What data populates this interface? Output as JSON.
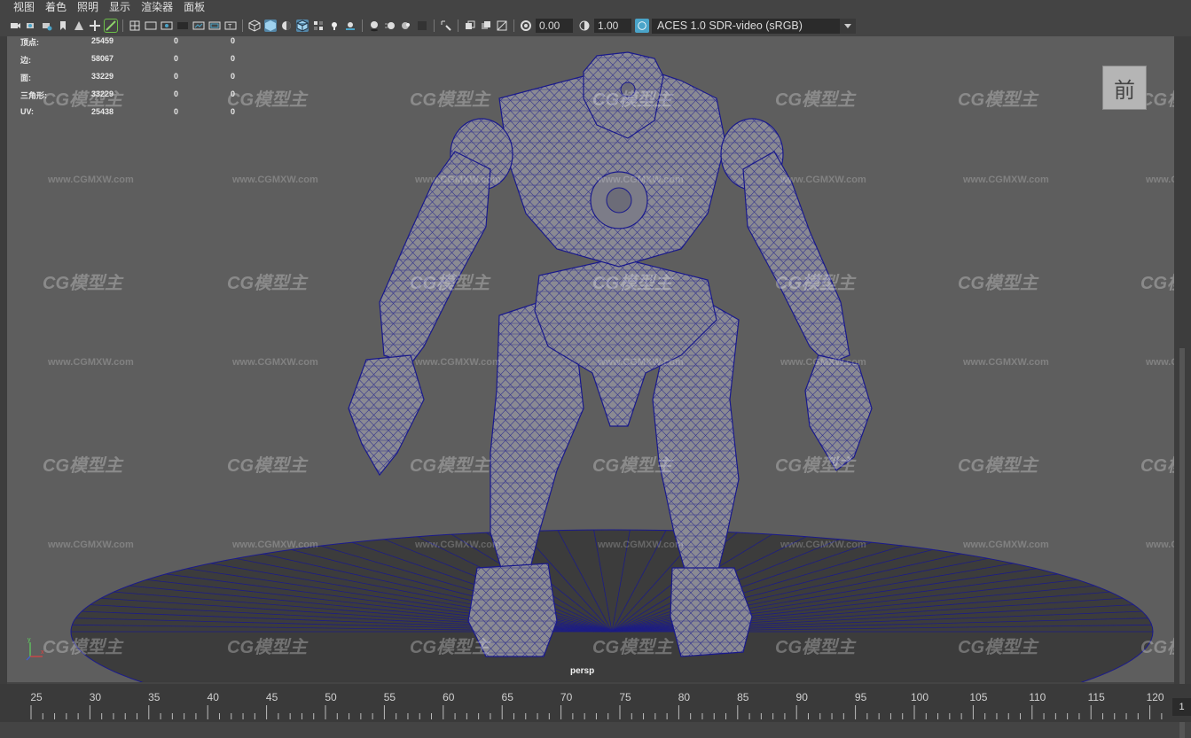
{
  "menu": [
    "视图",
    "着色",
    "照明",
    "显示",
    "渲染器",
    "面板"
  ],
  "toolbar": {
    "exposure_value": "0.00",
    "gamma_value": "1.00",
    "color_management_view": "ACES 1.0 SDR-video (sRGB)",
    "icons": [
      "camera-select-icon",
      "camera-attributes-icon",
      "bookmark-icon",
      "image-plane-icon",
      "grease-pencil-icon",
      "grid-icon",
      "film-gate-icon",
      "resolution-gate-icon",
      "safe-area-icon",
      "wireframe-icon",
      "smooth-shade-icon",
      "wireframe-on-shaded-icon",
      "textured-icon",
      "lights-icon",
      "shadows-icon",
      "ambient-occlusion-icon",
      "motion-blur-icon",
      "anti-alias-icon",
      "depth-of-field-icon",
      "isolate-select-icon",
      "xray-icon",
      "xray-joints-icon",
      "backface-culling-icon",
      "exposure-icon",
      "gamma-icon"
    ]
  },
  "hud": {
    "rows": [
      {
        "label": "顶点:",
        "v1": "25459",
        "v2": "0",
        "v3": "0"
      },
      {
        "label": "边:",
        "v1": "58067",
        "v2": "0",
        "v3": "0"
      },
      {
        "label": "面:",
        "v1": "33229",
        "v2": "0",
        "v3": "0"
      },
      {
        "label": "三角形:",
        "v1": "33229",
        "v2": "0",
        "v3": "0"
      },
      {
        "label": "UV:",
        "v1": "25438",
        "v2": "0",
        "v3": "0"
      }
    ]
  },
  "viewcube_label": "前",
  "camera_label": "persp",
  "axis": {
    "y_label": "y",
    "x_label": "x"
  },
  "watermark": {
    "logo_text": "CG模型主",
    "url_text": "www.CGMXW.com"
  },
  "timeline": {
    "ticks": [
      "25",
      "30",
      "35",
      "40",
      "45",
      "50",
      "55",
      "60",
      "65",
      "70",
      "75",
      "80",
      "85",
      "90",
      "95",
      "100",
      "105",
      "110",
      "115",
      "120"
    ],
    "current_frame": "1"
  },
  "colors": {
    "viewport_bg": "#5e5e5e",
    "wireframe": "#1a1a8c",
    "mesh_fill": "#8a8a93",
    "active_icon": "#5285a6"
  }
}
